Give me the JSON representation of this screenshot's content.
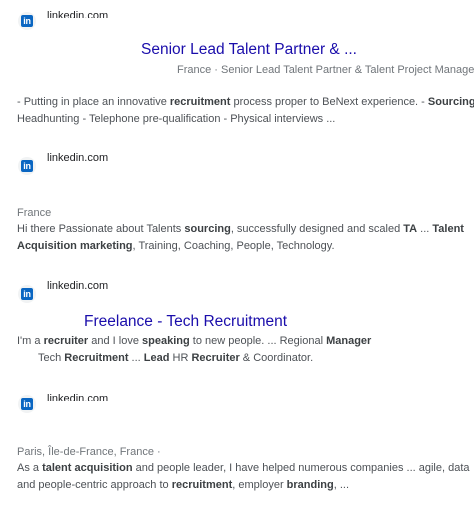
{
  "results": [
    {
      "site": "linkedin.com",
      "title": "Senior Lead Talent Partner & ...",
      "meta": "France · Senior Lead Talent Partner & Talent Project Manager",
      "snippet_lines": [
        [
          "- Putting in place an innovative ",
          "recruitment",
          " process proper to BeNext experience. - ",
          "Sourcing",
          " &"
        ],
        [
          "Headhunting - Telephone pre-qualification - Physical interviews ..."
        ]
      ]
    },
    {
      "site": "linkedin.com",
      "meta": "France",
      "snippet_lines": [
        [
          "Hi there Passionate about Talents ",
          "sourcing",
          ", successfully designed and scaled ",
          "TA",
          " ... ",
          "Talent"
        ],
        [
          "Acquisition marketing",
          ", Training, Coaching, People, Technology."
        ]
      ]
    },
    {
      "site": "linkedin.com",
      "title": "Freelance - Tech Recruitment",
      "snippet_lines": [
        [
          "I'm a ",
          "recruiter",
          " and I love ",
          "speaking",
          " to new people. ... Regional ",
          "Manager"
        ],
        [
          "Tech ",
          "Recruitment",
          " ... ",
          "Lead",
          " HR ",
          "Recruiter",
          " & Coordinator."
        ]
      ]
    },
    {
      "site": "linkedin.com",
      "meta": "Paris, Île-de-France, France ·",
      "snippet_lines": [
        [
          "As a ",
          "talent acquisition",
          " and people leader, I have helped numerous companies ... agile, data"
        ],
        [
          "and people-centric approach to ",
          "recruitment",
          ", employer ",
          "branding",
          ", ..."
        ]
      ]
    }
  ],
  "icons": {
    "linkedin": "linkedin-icon",
    "linkedin_glyph": "in",
    "linkedin_color": "#0a66c2"
  }
}
